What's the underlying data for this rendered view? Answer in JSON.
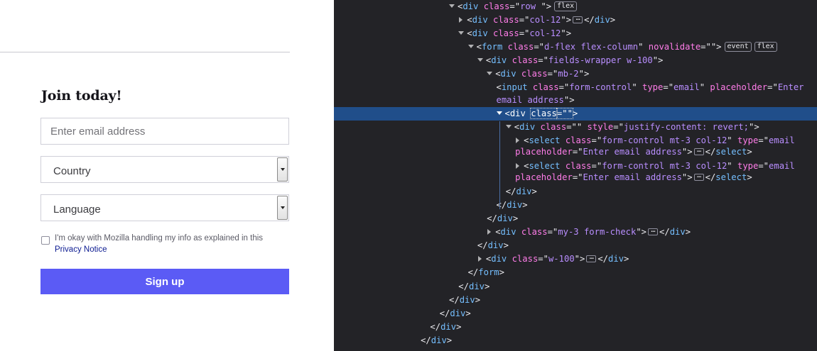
{
  "form": {
    "title": "Join today!",
    "email_placeholder": "Enter email address",
    "country_value": "Country",
    "language_value": "Language",
    "consent_text": "I'm okay with Mozilla handling my info as explained in this",
    "consent_link": "Privacy Notice",
    "submit_label": "Sign up"
  },
  "devtools": {
    "lines": [
      {
        "indent": 0,
        "tw": "open",
        "t": [
          [
            "punc",
            "<"
          ],
          [
            "tag",
            "div"
          ],
          [
            "sp",
            " "
          ],
          [
            "attr",
            "class"
          ],
          [
            "punc",
            "=\""
          ],
          [
            "val",
            "row "
          ],
          [
            "punc",
            "\">"
          ]
        ],
        "badges": [
          "flex"
        ]
      },
      {
        "indent": 1,
        "tw": "closed",
        "t": [
          [
            "punc",
            "<"
          ],
          [
            "tag",
            "div"
          ],
          [
            "sp",
            " "
          ],
          [
            "attr",
            "class"
          ],
          [
            "punc",
            "=\""
          ],
          [
            "val",
            "col-12"
          ],
          [
            "punc",
            "\">"
          ],
          [
            "ell",
            ""
          ],
          [
            "punc",
            "</"
          ],
          [
            "tag",
            "div"
          ],
          [
            "punc",
            ">"
          ]
        ]
      },
      {
        "indent": 1,
        "tw": "open",
        "t": [
          [
            "punc",
            "<"
          ],
          [
            "tag",
            "div"
          ],
          [
            "sp",
            " "
          ],
          [
            "attr",
            "class"
          ],
          [
            "punc",
            "=\""
          ],
          [
            "val",
            "col-12"
          ],
          [
            "punc",
            "\">"
          ]
        ]
      },
      {
        "indent": 2,
        "tw": "open",
        "t": [
          [
            "punc",
            "<"
          ],
          [
            "tag",
            "form"
          ],
          [
            "sp",
            " "
          ],
          [
            "attr",
            "class"
          ],
          [
            "punc",
            "=\""
          ],
          [
            "val",
            "d-flex flex-column"
          ],
          [
            "punc",
            "\" "
          ],
          [
            "attr",
            "novalidate"
          ],
          [
            "punc",
            "=\"\">"
          ]
        ],
        "badges": [
          "event",
          "flex"
        ]
      },
      {
        "indent": 3,
        "tw": "open",
        "t": [
          [
            "punc",
            "<"
          ],
          [
            "tag",
            "div"
          ],
          [
            "sp",
            " "
          ],
          [
            "attr",
            "class"
          ],
          [
            "punc",
            "=\""
          ],
          [
            "val",
            "fields-wrapper w-100"
          ],
          [
            "punc",
            "\">"
          ]
        ]
      },
      {
        "indent": 4,
        "tw": "open",
        "t": [
          [
            "punc",
            "<"
          ],
          [
            "tag",
            "div"
          ],
          [
            "sp",
            " "
          ],
          [
            "attr",
            "class"
          ],
          [
            "punc",
            "=\""
          ],
          [
            "val",
            "mb-2"
          ],
          [
            "punc",
            "\">"
          ]
        ]
      },
      {
        "indent": 5,
        "tw": "none",
        "t": [
          [
            "punc",
            "<"
          ],
          [
            "tag",
            "input"
          ],
          [
            "sp",
            " "
          ],
          [
            "attr",
            "class"
          ],
          [
            "punc",
            "=\""
          ],
          [
            "val",
            "form-control"
          ],
          [
            "punc",
            "\" "
          ],
          [
            "attr",
            "type"
          ],
          [
            "punc",
            "=\""
          ],
          [
            "val",
            "email"
          ],
          [
            "punc",
            "\" "
          ],
          [
            "attr",
            "placeholder"
          ],
          [
            "punc",
            "=\""
          ],
          [
            "val",
            "Enter"
          ]
        ]
      },
      {
        "indent": 5,
        "tw": "none",
        "cont": true,
        "t": [
          [
            "val",
            "email address"
          ],
          [
            "punc",
            "\">"
          ]
        ]
      },
      {
        "indent": 5,
        "tw": "open",
        "sel": true,
        "t": [
          [
            "punc",
            "<"
          ],
          [
            "tag",
            "div"
          ],
          [
            "sp",
            " "
          ],
          [
            "attr",
            "class",
            "outline"
          ],
          [
            "punc",
            "=\"\"",
            "outline"
          ],
          [
            "punc",
            ">"
          ]
        ]
      },
      {
        "indent": 6,
        "tw": "open",
        "t": [
          [
            "punc",
            "<"
          ],
          [
            "tag",
            "div"
          ],
          [
            "sp",
            " "
          ],
          [
            "attr",
            "class"
          ],
          [
            "punc",
            "=\"\" "
          ],
          [
            "attr",
            "style"
          ],
          [
            "punc",
            "=\""
          ],
          [
            "val",
            "justify-content: revert;"
          ],
          [
            "punc",
            "\">"
          ]
        ]
      },
      {
        "indent": 7,
        "tw": "closed",
        "t": [
          [
            "punc",
            "<"
          ],
          [
            "tag",
            "select"
          ],
          [
            "sp",
            " "
          ],
          [
            "attr",
            "class"
          ],
          [
            "punc",
            "=\""
          ],
          [
            "val",
            "form-control mt-3 col-12"
          ],
          [
            "punc",
            "\" "
          ],
          [
            "attr",
            "type"
          ],
          [
            "punc",
            "=\""
          ],
          [
            "val",
            "email"
          ]
        ]
      },
      {
        "indent": 7,
        "tw": "none",
        "cont": true,
        "t": [
          [
            "attr",
            "placeholder"
          ],
          [
            "punc",
            "=\""
          ],
          [
            "val",
            "Enter email address"
          ],
          [
            "punc",
            "\">"
          ],
          [
            "ell",
            ""
          ],
          [
            "punc",
            "</"
          ],
          [
            "tag",
            "select"
          ],
          [
            "punc",
            ">"
          ]
        ]
      },
      {
        "indent": 7,
        "tw": "closed",
        "t": [
          [
            "punc",
            "<"
          ],
          [
            "tag",
            "select"
          ],
          [
            "sp",
            " "
          ],
          [
            "attr",
            "class"
          ],
          [
            "punc",
            "=\""
          ],
          [
            "val",
            "form-control mt-3 col-12"
          ],
          [
            "punc",
            "\" "
          ],
          [
            "attr",
            "type"
          ],
          [
            "punc",
            "=\""
          ],
          [
            "val",
            "email"
          ]
        ]
      },
      {
        "indent": 7,
        "tw": "none",
        "cont": true,
        "t": [
          [
            "attr",
            "placeholder"
          ],
          [
            "punc",
            "=\""
          ],
          [
            "val",
            "Enter email address"
          ],
          [
            "punc",
            "\">"
          ],
          [
            "ell",
            ""
          ],
          [
            "punc",
            "</"
          ],
          [
            "tag",
            "select"
          ],
          [
            "punc",
            ">"
          ]
        ]
      },
      {
        "indent": 6,
        "tw": "none",
        "t": [
          [
            "punc",
            "</"
          ],
          [
            "tag",
            "div"
          ],
          [
            "punc",
            ">"
          ]
        ]
      },
      {
        "indent": 5,
        "tw": "none",
        "t": [
          [
            "punc",
            "</"
          ],
          [
            "tag",
            "div"
          ],
          [
            "punc",
            ">"
          ]
        ]
      },
      {
        "indent": 4,
        "tw": "none",
        "t": [
          [
            "punc",
            "</"
          ],
          [
            "tag",
            "div"
          ],
          [
            "punc",
            ">"
          ]
        ]
      },
      {
        "indent": 4,
        "tw": "closed",
        "t": [
          [
            "punc",
            "<"
          ],
          [
            "tag",
            "div"
          ],
          [
            "sp",
            " "
          ],
          [
            "attr",
            "class"
          ],
          [
            "punc",
            "=\""
          ],
          [
            "val",
            "my-3 form-check"
          ],
          [
            "punc",
            "\">"
          ],
          [
            "ell",
            ""
          ],
          [
            "punc",
            "</"
          ],
          [
            "tag",
            "div"
          ],
          [
            "punc",
            ">"
          ]
        ]
      },
      {
        "indent": 3,
        "tw": "none",
        "t": [
          [
            "punc",
            "</"
          ],
          [
            "tag",
            "div"
          ],
          [
            "punc",
            ">"
          ]
        ]
      },
      {
        "indent": 3,
        "tw": "closed",
        "t": [
          [
            "punc",
            "<"
          ],
          [
            "tag",
            "div"
          ],
          [
            "sp",
            " "
          ],
          [
            "attr",
            "class"
          ],
          [
            "punc",
            "=\""
          ],
          [
            "val",
            "w-100"
          ],
          [
            "punc",
            "\">"
          ],
          [
            "ell",
            ""
          ],
          [
            "punc",
            "</"
          ],
          [
            "tag",
            "div"
          ],
          [
            "punc",
            ">"
          ]
        ]
      },
      {
        "indent": 2,
        "tw": "none",
        "t": [
          [
            "punc",
            "</"
          ],
          [
            "tag",
            "form"
          ],
          [
            "punc",
            ">"
          ]
        ]
      },
      {
        "indent": 1,
        "tw": "none",
        "t": [
          [
            "punc",
            "</"
          ],
          [
            "tag",
            "div"
          ],
          [
            "punc",
            ">"
          ]
        ]
      },
      {
        "indent": 0,
        "tw": "none",
        "t": [
          [
            "punc",
            "</"
          ],
          [
            "tag",
            "div"
          ],
          [
            "punc",
            ">"
          ]
        ]
      },
      {
        "indent": -1,
        "tw": "none",
        "t": [
          [
            "punc",
            "</"
          ],
          [
            "tag",
            "div"
          ],
          [
            "punc",
            ">"
          ]
        ]
      },
      {
        "indent": -2,
        "tw": "none",
        "t": [
          [
            "punc",
            "</"
          ],
          [
            "tag",
            "div"
          ],
          [
            "punc",
            ">"
          ]
        ]
      },
      {
        "indent": -3,
        "tw": "none",
        "t": [
          [
            "punc",
            "</"
          ],
          [
            "tag",
            "div"
          ],
          [
            "punc",
            ">"
          ]
        ]
      }
    ]
  }
}
